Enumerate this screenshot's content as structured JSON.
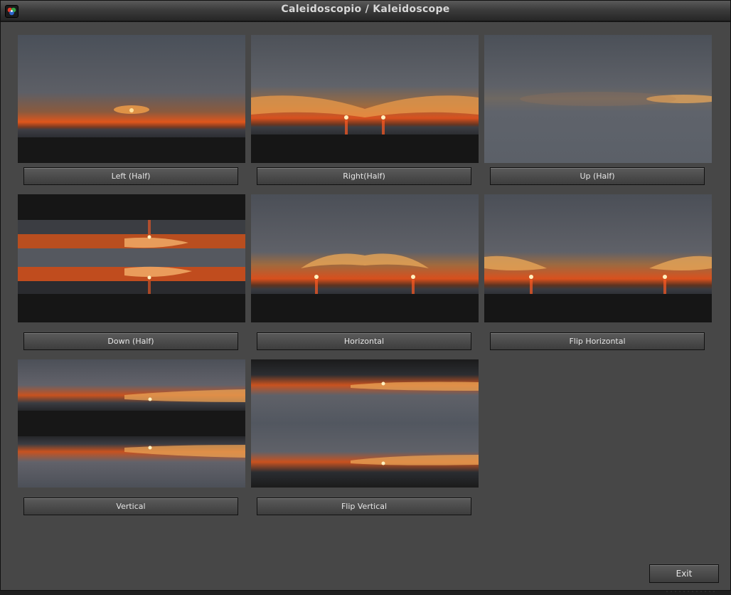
{
  "window": {
    "title": "Caleidoscopio / Kaleidoscope",
    "app_icon": "kaleidoscope-app-icon"
  },
  "effects": [
    {
      "id": "left-half",
      "label": "Left (Half)"
    },
    {
      "id": "right-half",
      "label": "Right(Half)"
    },
    {
      "id": "up-half",
      "label": "Up (Half)"
    },
    {
      "id": "down-half",
      "label": "Down (Half)"
    },
    {
      "id": "horizontal",
      "label": "Horizontal"
    },
    {
      "id": "flip-horizontal",
      "label": "Flip Horizontal"
    },
    {
      "id": "vertical",
      "label": "Vertical"
    },
    {
      "id": "flip-vertical",
      "label": "Flip Vertical"
    }
  ],
  "footer": {
    "exit_label": "Exit"
  },
  "colors": {
    "window_bg": "#474747",
    "button_text": "#e6e6e6",
    "sun": "#ff4a1a",
    "sky_glow": "#e0561c"
  }
}
